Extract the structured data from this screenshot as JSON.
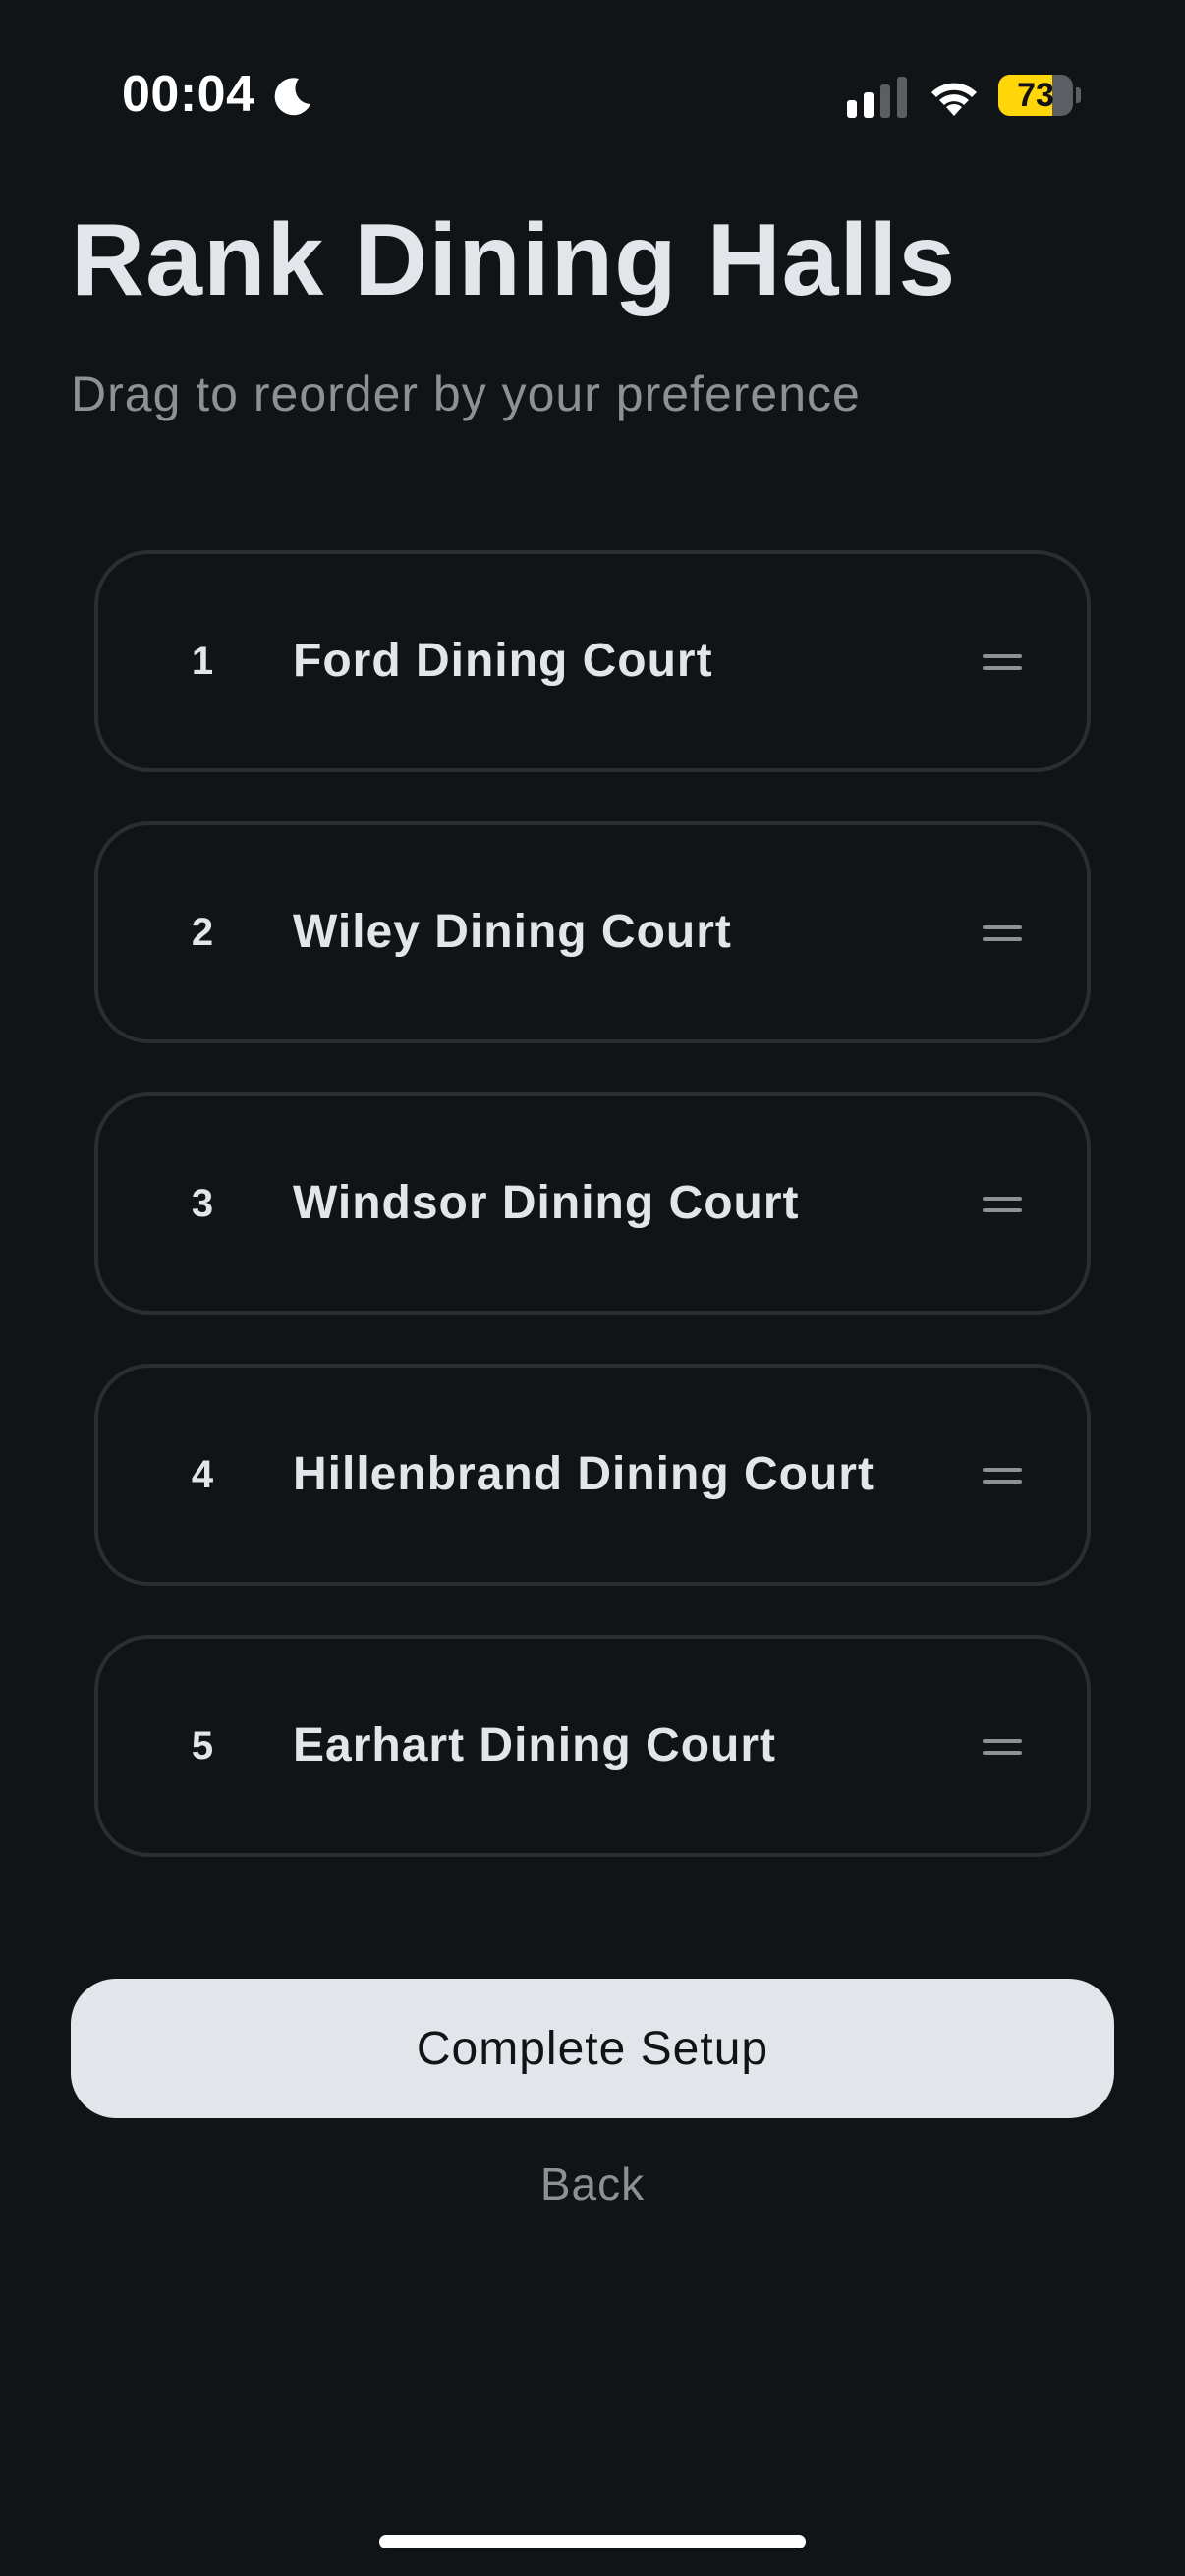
{
  "status_bar": {
    "time": "00:04",
    "battery_percent": 73,
    "battery_label": "73",
    "battery_color": "#ffd60a",
    "icons": [
      "moon-icon",
      "cellular-signal-icon",
      "wifi-icon",
      "battery-icon"
    ]
  },
  "header": {
    "title": "Rank Dining Halls",
    "subtitle": "Drag to reorder by your preference"
  },
  "rank_list": {
    "items": [
      {
        "rank": "1",
        "label": "Ford Dining Court"
      },
      {
        "rank": "2",
        "label": "Wiley Dining Court"
      },
      {
        "rank": "3",
        "label": "Windsor Dining Court"
      },
      {
        "rank": "4",
        "label": "Hillenbrand Dining Court"
      },
      {
        "rank": "5",
        "label": "Earhart Dining Court"
      }
    ],
    "handle_icon": "drag-handle-icon"
  },
  "actions": {
    "complete_label": "Complete Setup",
    "back_label": "Back"
  },
  "colors": {
    "background": "#111417",
    "primary_text": "#e2e5e9",
    "secondary_text": "#8c9196",
    "card_border": "#2a2d31",
    "button_bg": "#e2e5e9"
  }
}
